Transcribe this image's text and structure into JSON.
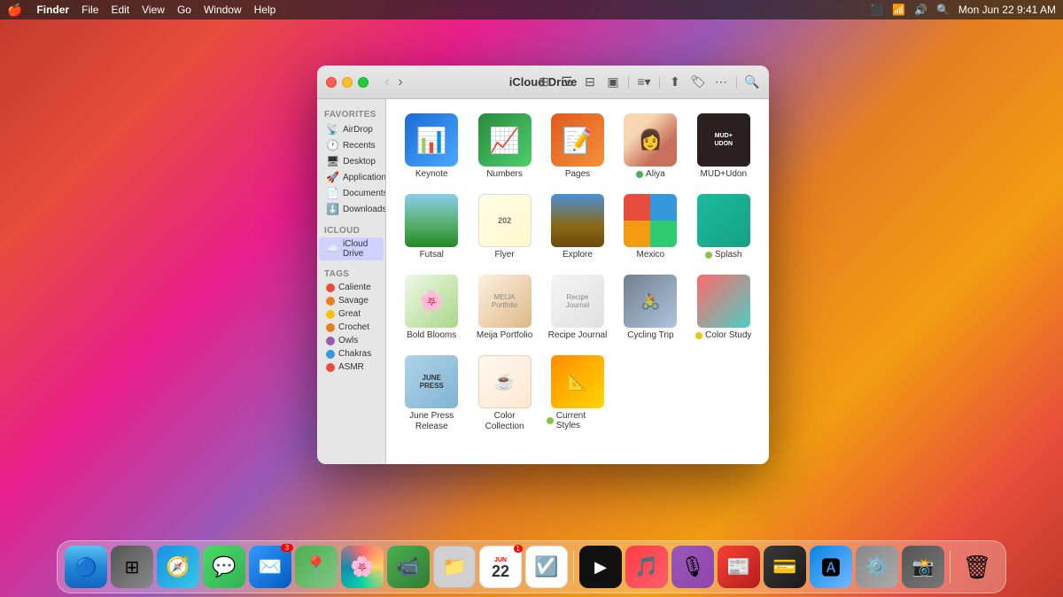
{
  "menubar": {
    "apple": "🍎",
    "app_name": "Finder",
    "menus": [
      "File",
      "Edit",
      "View",
      "Go",
      "Window",
      "Help"
    ],
    "right_items": [
      "Mon Jun 22",
      "9:41 AM"
    ],
    "battery_icon": "battery-icon",
    "wifi_icon": "wifi-icon",
    "time": "Mon Jun 22  9:41 AM"
  },
  "finder": {
    "title": "iCloud Drive",
    "toolbar": {
      "back_label": "‹",
      "forward_label": "›",
      "view_icons": [
        "grid",
        "list",
        "columns",
        "gallery"
      ],
      "action_icons": [
        "share",
        "tag",
        "more"
      ],
      "search": "search"
    },
    "sidebar": {
      "favorites_label": "Favorites",
      "favorites": [
        {
          "name": "AirDrop",
          "icon": "📡"
        },
        {
          "name": "Recents",
          "icon": "🕐"
        },
        {
          "name": "Desktop",
          "icon": "🖥"
        },
        {
          "name": "Applications",
          "icon": "🚀"
        },
        {
          "name": "Documents",
          "icon": "📄"
        },
        {
          "name": "Downloads",
          "icon": "⬇️"
        }
      ],
      "icloud_label": "iCloud",
      "icloud": [
        {
          "name": "iCloud Drive",
          "icon": "☁️",
          "active": true
        }
      ],
      "tags_label": "Tags",
      "tags": [
        {
          "name": "Caliente",
          "color": "#e74c3c"
        },
        {
          "name": "Savage",
          "color": "#e67e22"
        },
        {
          "name": "Great",
          "color": "#f1c40f"
        },
        {
          "name": "Crochet",
          "color": "#e67e22"
        },
        {
          "name": "Owls",
          "color": "#9b59b6"
        },
        {
          "name": "Chakras",
          "color": "#3498db"
        },
        {
          "name": "ASMR",
          "color": "#e74c3c"
        }
      ]
    },
    "files": [
      {
        "name": "Keynote",
        "type": "app",
        "color1": "#1a6dd4",
        "color2": "#4aa8ff",
        "emoji": "📊"
      },
      {
        "name": "Numbers",
        "type": "app",
        "color1": "#2a8a3e",
        "color2": "#4dcf6e",
        "emoji": "📈"
      },
      {
        "name": "Pages",
        "type": "app",
        "color1": "#e05a1e",
        "color2": "#f5903a",
        "emoji": "📝"
      },
      {
        "name": "Aliya",
        "type": "photo",
        "thumb": "aliya",
        "dot": null
      },
      {
        "name": "MUD+Udon",
        "type": "photo",
        "thumb": "mud-udon",
        "dot": null
      },
      {
        "name": "Futsal",
        "type": "photo",
        "thumb": "futsal",
        "dot": null
      },
      {
        "name": "Flyer",
        "type": "photo",
        "thumb": "flyer",
        "dot": null
      },
      {
        "name": "Explore",
        "type": "photo",
        "thumb": "explore",
        "dot": null
      },
      {
        "name": "Mexico",
        "type": "photo",
        "thumb": "mexico",
        "dot": null
      },
      {
        "name": "Splash",
        "type": "photo",
        "thumb": "splash",
        "dot": "#8BC34A"
      },
      {
        "name": "Bold Blooms",
        "type": "photo",
        "thumb": "bold-blooms",
        "dot": null
      },
      {
        "name": "Meija Portfolio",
        "type": "photo",
        "thumb": "meija",
        "dot": null
      },
      {
        "name": "Recipe Journal",
        "type": "photo",
        "thumb": "recipe",
        "dot": null
      },
      {
        "name": "Cycling Trip",
        "type": "photo",
        "thumb": "cycling",
        "dot": null
      },
      {
        "name": "Color Study",
        "type": "photo",
        "thumb": "color-study",
        "dot": "#f1c40f"
      },
      {
        "name": "June Press Release",
        "type": "photo",
        "thumb": "june-press",
        "dot": null
      },
      {
        "name": "Color Collection",
        "type": "photo",
        "thumb": "color-collection",
        "dot": null
      },
      {
        "name": "Current Styles",
        "type": "photo",
        "thumb": "current-styles",
        "dot": "#8BC34A"
      }
    ]
  },
  "dock": {
    "items": [
      {
        "name": "Finder",
        "emoji": "🔵",
        "class": "dock-finder"
      },
      {
        "name": "Launchpad",
        "emoji": "⊞",
        "class": "dock-launchpad"
      },
      {
        "name": "Safari",
        "emoji": "🧭",
        "class": "dock-safari"
      },
      {
        "name": "Messages",
        "emoji": "💬",
        "class": "dock-messages"
      },
      {
        "name": "Mail",
        "emoji": "✉️",
        "class": "dock-mail"
      },
      {
        "name": "Maps",
        "emoji": "🗺",
        "class": "dock-maps"
      },
      {
        "name": "Photos",
        "emoji": "🌸",
        "class": "dock-photos"
      },
      {
        "name": "FaceTime",
        "emoji": "📹",
        "class": "dock-facetime"
      },
      {
        "name": "Files",
        "emoji": "📁",
        "class": "dock-files"
      },
      {
        "name": "Calendar",
        "emoji": "📅",
        "class": "dock-calendar"
      },
      {
        "name": "Reminders",
        "emoji": "☑️",
        "class": "dock-reminders"
      },
      {
        "name": "Apple TV",
        "emoji": "📺",
        "class": "dock-appletv"
      },
      {
        "name": "Music",
        "emoji": "🎵",
        "class": "dock-music"
      },
      {
        "name": "Podcasts",
        "emoji": "🎙",
        "class": "dock-podcasts"
      },
      {
        "name": "News",
        "emoji": "📰",
        "class": "dock-news"
      },
      {
        "name": "Wallet",
        "emoji": "💳",
        "class": "dock-wallet"
      },
      {
        "name": "App Store",
        "emoji": "🅰",
        "class": "dock-appstore"
      },
      {
        "name": "System Preferences",
        "emoji": "⚙️",
        "class": "dock-syspreferences"
      },
      {
        "name": "Trash",
        "emoji": "🗑",
        "class": "dock-trash"
      }
    ]
  }
}
